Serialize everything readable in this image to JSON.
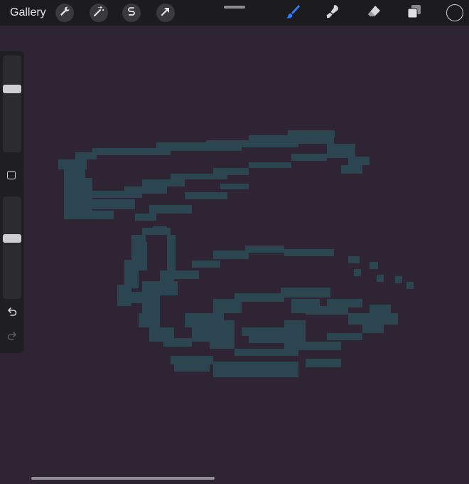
{
  "toolbar": {
    "gallery_label": "Gallery",
    "left_tools": [
      {
        "icon": "wrench-icon"
      },
      {
        "icon": "magic-wand-icon"
      },
      {
        "icon": "selection-s-icon"
      },
      {
        "icon": "transform-arrow-icon"
      }
    ],
    "right_tools": [
      {
        "icon": "brush-icon",
        "active": true
      },
      {
        "icon": "smudge-icon"
      },
      {
        "icon": "eraser-icon"
      },
      {
        "icon": "layers-icon"
      }
    ],
    "current_color": "#1c1c1e",
    "active_tool_color": "#2f7cf6"
  },
  "sidebar": {
    "brush_size_level": 0.67,
    "brush_opacity_level": 0.6,
    "undo_icon": "undo-icon",
    "redo_icon": "redo-icon",
    "redo_enabled": false
  },
  "canvas": {
    "background_color": "#2e2433",
    "stroke_color": "#2b4650"
  }
}
